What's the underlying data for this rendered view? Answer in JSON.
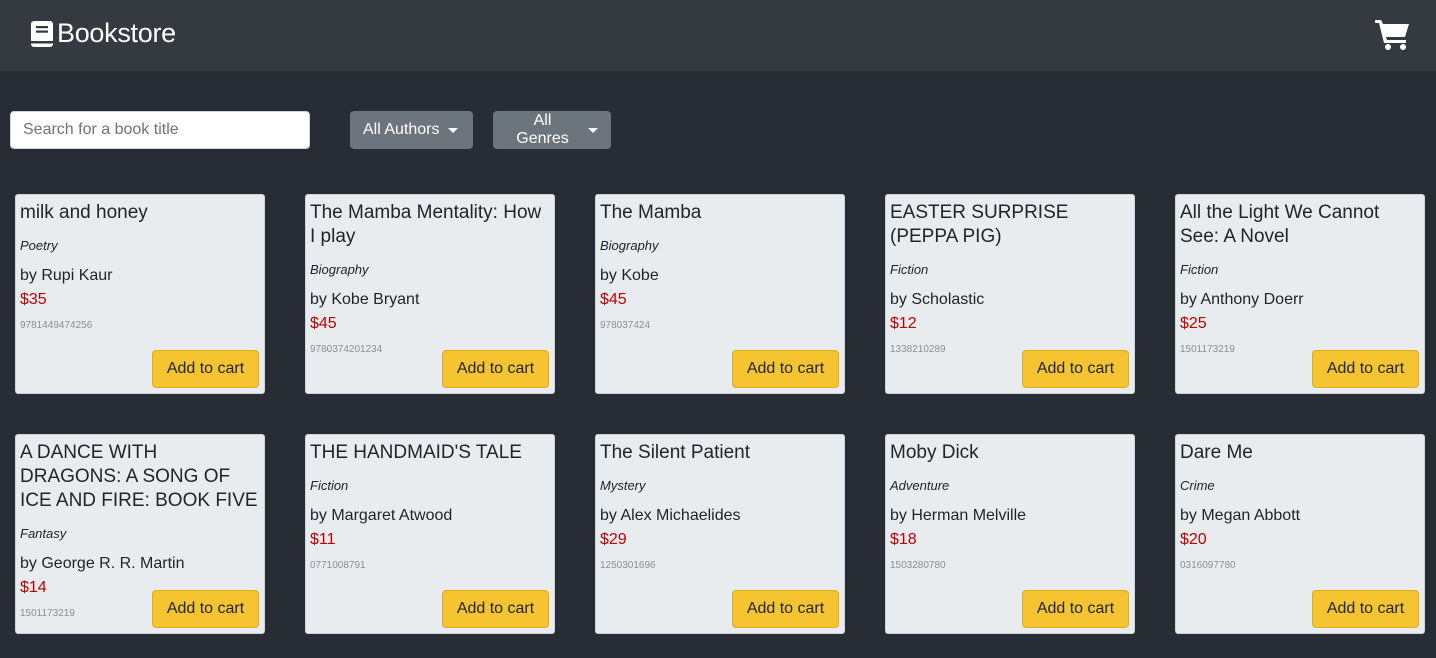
{
  "navbar": {
    "brand": "Bookstore",
    "brand_icon": "book-icon",
    "cart_icon": "shopping-cart-icon"
  },
  "filters": {
    "search_placeholder": "Search for a book title",
    "authors_label": "All Authors",
    "genres_label": "All Genres"
  },
  "add_label": "Add to cart",
  "colors": {
    "navbar": "#343a40",
    "background": "#282c34",
    "price": "#c00000",
    "add_button": "#f6c431",
    "dropdown": "#6c757d"
  },
  "books": [
    {
      "title": "milk and honey",
      "genre": "Poetry",
      "author": "by Rupi Kaur",
      "price": "$35",
      "isbn": "9781449474256"
    },
    {
      "title": "The Mamba Mentality: How I play",
      "genre": "Biography",
      "author": "by Kobe Bryant",
      "price": "$45",
      "isbn": "9780374201234"
    },
    {
      "title": "The Mamba",
      "genre": "Biography",
      "author": "by Kobe",
      "price": "$45",
      "isbn": "978037424"
    },
    {
      "title": "EASTER SURPRISE (PEPPA PIG)",
      "genre": "Fiction",
      "author": "by Scholastic",
      "price": "$12",
      "isbn": "1338210289"
    },
    {
      "title": "All the Light We Cannot See: A Novel",
      "genre": "Fiction",
      "author": "by Anthony Doerr",
      "price": "$25",
      "isbn": "1501173219"
    },
    {
      "title": "A DANCE WITH DRAGONS: A SONG OF ICE AND FIRE: BOOK FIVE",
      "genre": "Fantasy",
      "author": "by George R. R. Martin",
      "price": "$14",
      "isbn": "1501173219"
    },
    {
      "title": "THE HANDMAID'S TALE",
      "genre": "Fiction",
      "author": "by Margaret Atwood",
      "price": "$11",
      "isbn": "0771008791"
    },
    {
      "title": "The Silent Patient",
      "genre": "Mystery",
      "author": "by Alex Michaelides",
      "price": "$29",
      "isbn": "1250301696"
    },
    {
      "title": "Moby Dick",
      "genre": "Adventure",
      "author": "by Herman Melville",
      "price": "$18",
      "isbn": "1503280780"
    },
    {
      "title": "Dare Me",
      "genre": "Crime",
      "author": "by Megan Abbott",
      "price": "$20",
      "isbn": "0316097780"
    }
  ]
}
